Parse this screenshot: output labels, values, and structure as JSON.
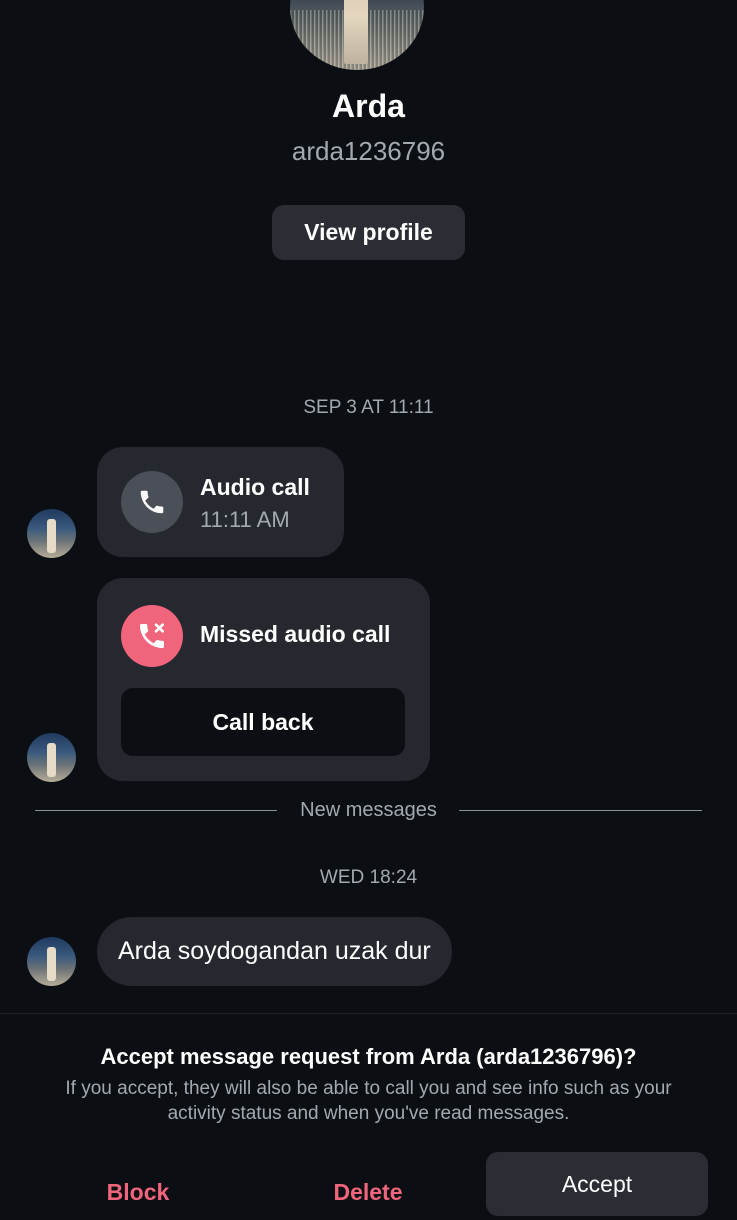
{
  "profile": {
    "name": "Arda",
    "username": "arda1236796",
    "view_profile_label": "View profile"
  },
  "conversation": {
    "timestamp_1": "SEP 3 AT 11:11",
    "audio_call": {
      "title": "Audio call",
      "time": "11:11 AM"
    },
    "missed_call": {
      "title": "Missed audio call",
      "call_back_label": "Call back"
    },
    "new_messages_label": "New messages",
    "timestamp_2": "WED 18:24",
    "message_text": "Arda soydogandan uzak dur"
  },
  "request": {
    "title": "Accept message request from Arda (arda1236796)?",
    "info": "If you accept, they will also be able to call you and see info such as your activity status and when you've read messages.",
    "block_label": "Block",
    "delete_label": "Delete",
    "accept_label": "Accept"
  },
  "colors": {
    "background": "#0b0e12",
    "bubble": "#25282e",
    "accent_red": "#f0657c",
    "muted_text": "#a4a8b0"
  },
  "icons": {
    "audio_call": "phone-icon",
    "missed_call": "missed-call-icon"
  }
}
